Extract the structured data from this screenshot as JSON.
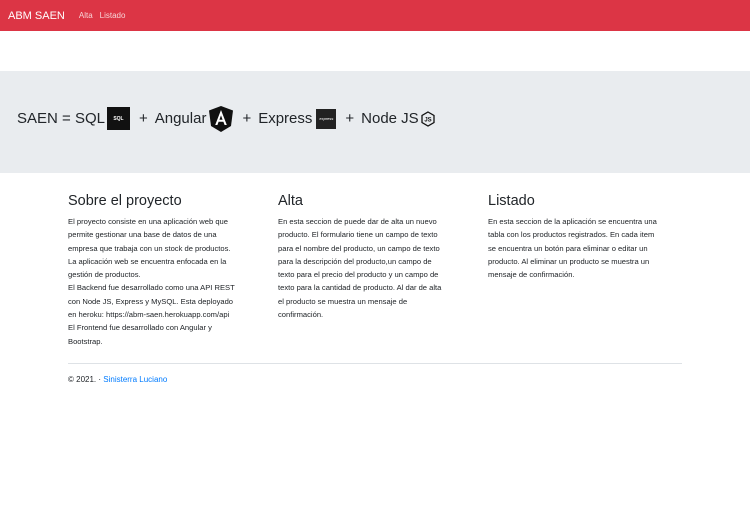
{
  "navbar": {
    "brand": "ABM SAEN",
    "links": [
      "Alta",
      "Listado"
    ]
  },
  "hero": {
    "prefix": "SAEN = SQL",
    "sql_badge": "SQL",
    "plus": "+",
    "angular": "Angular",
    "express": "Express",
    "express_badge": "express",
    "node": "Node JS"
  },
  "sections": [
    {
      "title": "Sobre el proyecto",
      "lines": [
        "El proyecto consiste en una aplicación web que",
        "permite gestionar una base de datos de una",
        "empresa que trabaja con un stock de productos.",
        "La aplicación web se encuentra enfocada en la",
        "gestión de productos.",
        "El Backend fue desarrollado como una API REST",
        "con Node JS, Express y MySQL. Esta deployado",
        "en heroku: https://abm-saen.herokuapp.com/api",
        "El Frontend fue desarrollado con Angular y",
        "Bootstrap."
      ]
    },
    {
      "title": "Alta",
      "lines": [
        "En esta seccion de puede dar de alta un nuevo",
        "producto. El formulario tiene un campo de texto",
        "para el nombre del producto, un campo de texto",
        "para la descripción del producto,un campo de",
        "texto para el precio del producto y un campo de",
        "texto para la cantidad de producto. Al dar de alta",
        "el producto se muestra un mensaje de",
        "confirmación."
      ]
    },
    {
      "title": "Listado",
      "lines": [
        "En esta seccion de la aplicación se encuentra una",
        "tabla con los productos registrados. En cada item",
        "se encuentra un botón para eliminar o editar un",
        "producto. Al eliminar un producto se muestra un",
        "mensaje de confirmación."
      ]
    }
  ],
  "footer": {
    "copyright": "© 2021. · ",
    "author": "Sinisterra Luciano"
  },
  "colors": {
    "navbar": "#dc3545",
    "jumbotron": "#e9ecef",
    "link": "#007bff"
  },
  "icons": [
    "sql-icon",
    "angular-icon",
    "express-icon",
    "nodejs-icon"
  ]
}
